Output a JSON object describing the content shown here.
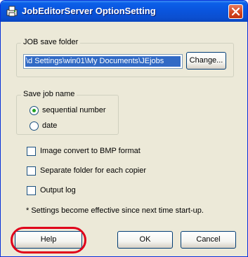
{
  "window": {
    "title": "JobEditorServer OptionSetting",
    "app_icon": "printer-app-icon",
    "close_icon": "close-x-icon",
    "accent_color": "#0a55de",
    "close_color": "#d2431d"
  },
  "job_save_folder": {
    "legend": "JOB save folder",
    "path_value": "\\d Settings\\win01\\My Documents\\JEjobs",
    "change_label": "Change..."
  },
  "save_job_name": {
    "legend": "Save job name",
    "options": [
      {
        "label": "sequential number",
        "selected": true
      },
      {
        "label": "date",
        "selected": false
      }
    ]
  },
  "checkboxes": [
    {
      "label": "Image convert to BMP format",
      "checked": false
    },
    {
      "label": "Separate folder for each copier",
      "checked": false
    },
    {
      "label": "Output log",
      "checked": false
    }
  ],
  "note": "* Settings become effective since next time start-up.",
  "buttons": {
    "help": "Help",
    "ok": "OK",
    "cancel": "Cancel"
  },
  "highlight_color": "#e0001a"
}
